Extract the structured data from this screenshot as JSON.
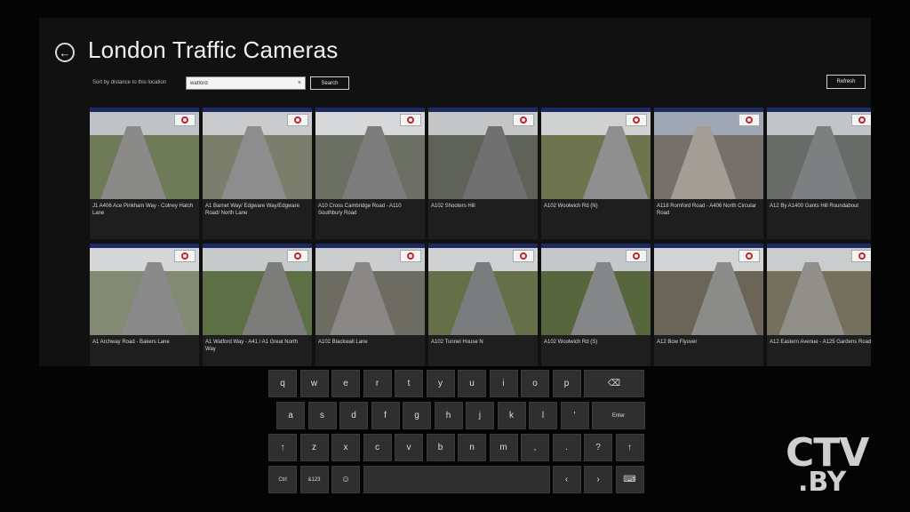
{
  "header": {
    "title": "London Traffic Cameras",
    "back_icon": "back-arrow-icon"
  },
  "toolbar": {
    "sort_label": "Sort by distance to this location",
    "search_value": "watford ",
    "clear_symbol": "×",
    "search_label": "Search",
    "refresh_label": "Refresh"
  },
  "cameras": [
    {
      "caption": "J1 A406 Ace Pinkham Way - Colney Hatch Lane",
      "palette": {
        "sky": "#bfc3c6",
        "ground": "#6f7a58",
        "road": "#8a8a88"
      }
    },
    {
      "caption": "A1 Barnet Way/ Edgware Way/Edgware Road/ North Lane",
      "palette": {
        "sky": "#c9cbcc",
        "ground": "#7a7e6a",
        "road": "#8d8d8d"
      }
    },
    {
      "caption": "A10 Cross Cambridge Road - A110 Southbury Road",
      "palette": {
        "sky": "#d6d8d9",
        "ground": "#6c6f63",
        "road": "#7c7c7c"
      }
    },
    {
      "caption": "A102 Shooters Hill",
      "palette": {
        "sky": "#c4c6c7",
        "ground": "#5e6258",
        "road": "#6f706f"
      }
    },
    {
      "caption": "A102 Woolwich Rd (N)",
      "palette": {
        "sky": "#d0d2d2",
        "ground": "#6d744e",
        "road": "#8f8f8f"
      }
    },
    {
      "caption": "A118 Romford Road - A406 North Circular Road",
      "palette": {
        "sky": "#9ea7b3",
        "ground": "#757069",
        "road": "#a29d95"
      }
    },
    {
      "caption": "A12 By A1400 Gants Hill Roundabout",
      "palette": {
        "sky": "#c2c5c7",
        "ground": "#686b67",
        "road": "#7e7f80"
      }
    },
    {
      "caption": "A1 Archway Road - Bakers Lane",
      "palette": {
        "sky": "#d4d6d7",
        "ground": "#838a74",
        "road": "#8a8a8a"
      }
    },
    {
      "caption": "A1 Watford Way - A41 / A1 Great North Way",
      "palette": {
        "sky": "#c8cbcc",
        "ground": "#5c6f45",
        "road": "#7c7c7a"
      }
    },
    {
      "caption": "A102 Blackwall Lane",
      "palette": {
        "sky": "#cbcdce",
        "ground": "#6c6c62",
        "road": "#8a8886"
      }
    },
    {
      "caption": "A102 Tunnel House N",
      "palette": {
        "sky": "#cfd1d2",
        "ground": "#657049",
        "road": "#7b7c7d"
      }
    },
    {
      "caption": "A102 Woolwich Rd (S)",
      "palette": {
        "sky": "#c6c9cb",
        "ground": "#58663e",
        "road": "#858688"
      }
    },
    {
      "caption": "A12 Bow Flyover",
      "palette": {
        "sky": "#d2d4d5",
        "ground": "#6a6556",
        "road": "#8b8b89"
      }
    },
    {
      "caption": "A12 Eastern Avenue - A125 Gardens Road",
      "palette": {
        "sky": "#cacdce",
        "ground": "#75705d",
        "road": "#908f8a"
      }
    }
  ],
  "keyboard": {
    "row1": [
      "q",
      "w",
      "e",
      "r",
      "t",
      "y",
      "u",
      "i",
      "o",
      "p"
    ],
    "backspace_icon": "backspace-icon",
    "row2": [
      "a",
      "s",
      "d",
      "f",
      "g",
      "h",
      "j",
      "k",
      "l",
      "'"
    ],
    "enter_label": "Enter",
    "shift_icon": "shift-arrow-icon",
    "row3": [
      "z",
      "x",
      "c",
      "v",
      "b",
      "n",
      "m",
      ",",
      "."
    ],
    "row3_extra": "?",
    "ctrl_label": "Ctrl",
    "symbols_label": "&123",
    "emoji_icon": "emoji-icon",
    "left_arrow": "‹",
    "right_arrow": "›",
    "keyboard_icon": "keyboard-icon"
  },
  "watermark": {
    "line1": "CTV",
    "line2": ".BY"
  }
}
